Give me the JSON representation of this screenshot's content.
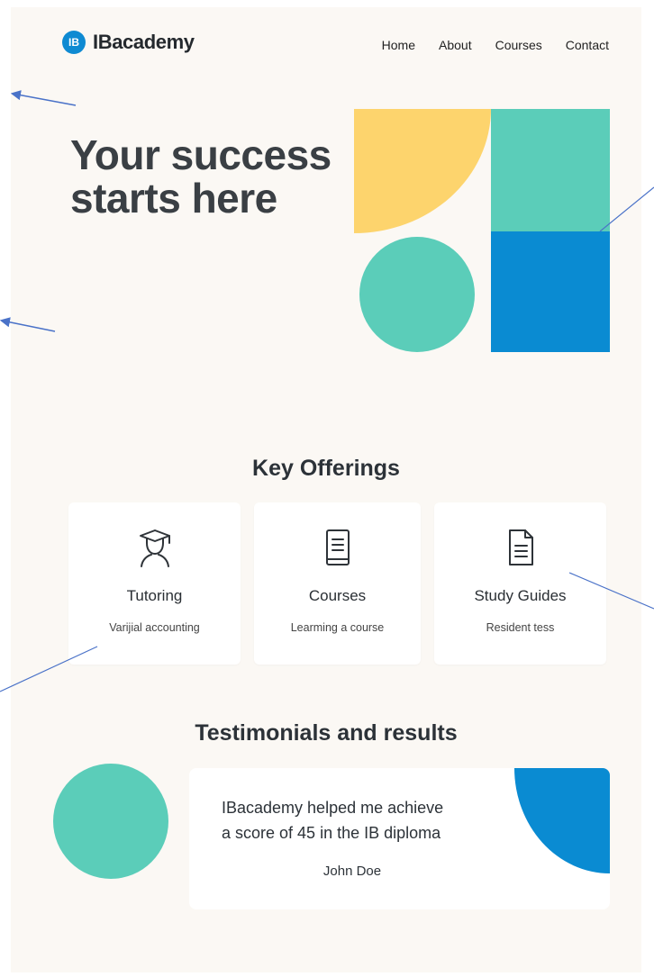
{
  "brand": {
    "badge": "IB",
    "name": "IBacademy"
  },
  "nav": {
    "items": [
      "Home",
      "About",
      "Courses",
      "Contact"
    ]
  },
  "hero": {
    "title_line1": "Your success",
    "title_line2": "starts here"
  },
  "colors": {
    "teal": "#5bcdb9",
    "yellow": "#fdd46d",
    "blue": "#0a8bd2",
    "background": "#fbf8f4",
    "annotation": "#4a72c8"
  },
  "offerings": {
    "title": "Key Offerings",
    "cards": [
      {
        "icon": "graduate-icon",
        "title": "Tutoring",
        "subtitle": "Varijial accounting"
      },
      {
        "icon": "book-icon",
        "title": "Courses",
        "subtitle": "Learming a course"
      },
      {
        "icon": "document-icon",
        "title": "Study Guides",
        "subtitle": "Resident tess"
      }
    ]
  },
  "testimonials": {
    "title": "Testimonials and results",
    "quote_line1": "IBacademy helped me achieve",
    "quote_line2": "a score of 45 in the IB diploma",
    "author": "John Doe"
  }
}
